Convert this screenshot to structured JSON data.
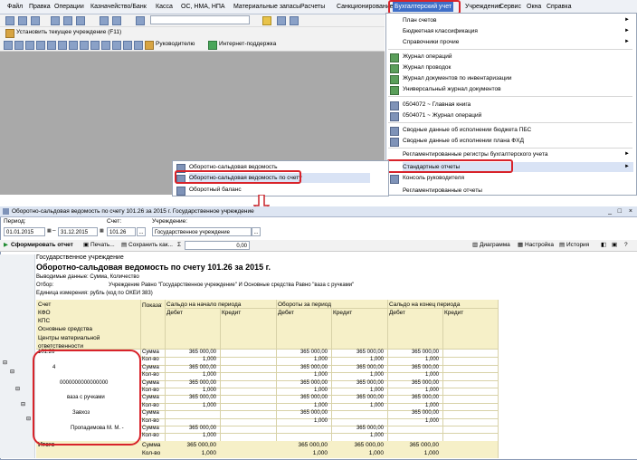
{
  "menu": [
    "Файл",
    "Правка",
    "Операции",
    "Казначейство/Банк",
    "Касса",
    "ОС, НМА, НПА",
    "Материальные запасы",
    "Расчеты",
    "Санкционирование",
    "Бухгалтерский учет",
    "Учреждение",
    "Сервис",
    "Окна",
    "Справка"
  ],
  "toolbar2": {
    "set_institution": "Установить текущее учреждение (F11)"
  },
  "toolbar3": {
    "manager": "Руководителю",
    "internet_support": "Интернет-поддержка"
  },
  "dropdown": {
    "items": [
      {
        "label": "План счетов",
        "arrow": "►"
      },
      {
        "label": "Бюджетная классификация",
        "arrow": "►"
      },
      {
        "label": "Справочники прочие",
        "arrow": "►"
      },
      {
        "label": "Журнал операций",
        "arrow": ""
      },
      {
        "label": "Журнал проводок",
        "arrow": ""
      },
      {
        "label": "Журнал документов по инвентаризации",
        "arrow": ""
      },
      {
        "label": "Универсальный журнал документов",
        "arrow": ""
      },
      {
        "label": "0504072 ~ Главная книга",
        "arrow": ""
      },
      {
        "label": "0504071 ~ Журнал операций",
        "arrow": ""
      },
      {
        "label": "Сводные данные об исполнении бюджета ПБС",
        "arrow": ""
      },
      {
        "label": "Сводные данные об исполнении плана ФХД",
        "arrow": ""
      },
      {
        "label": "Регламентированные регистры бухгалтерского учета",
        "arrow": "►"
      },
      {
        "label": "Стандартные отчеты",
        "arrow": "►"
      },
      {
        "label": "Консоль руководителя",
        "arrow": ""
      },
      {
        "label": "Регламентированные отчеты",
        "arrow": ""
      }
    ]
  },
  "submenu": [
    "Оборотно-сальдовая ведомость",
    "Оборотно-сальдовая ведомость по счету",
    "Оборотный баланс"
  ],
  "window": {
    "title": "Оборотно-сальдовая ведомость по счету 101.26 за 2015 г. Государственное учреждение",
    "period_label": "Период:",
    "date_from": "01.01.2015",
    "date_to": "31.12.2015",
    "account_label": "Счет:",
    "account": "101.26",
    "institution_label": "Учреждение:",
    "institution": "Государственное учреждение"
  },
  "report_toolbar": {
    "generate": "Сформировать отчет",
    "print": "Печать...",
    "save_as": "Сохранить как...",
    "sum_value": "0,00",
    "diagram": "Диаграмма",
    "settings": "Настройка",
    "history": "История"
  },
  "report": {
    "org": "Государственное учреждение",
    "title": "Оборотно-сальдовая ведомость по счету 101.26 за 2015 г.",
    "output_data": "Выводимые данные:  Сумма, Количество",
    "filter_label": "Отбор:",
    "filter": "Учреждение Равно \"Государственное учреждение\" И Основные средства Равно \"ваза с ручками\"",
    "unit": "Единица измерения: рубль (код по ОКЕИ 383)",
    "header_left": [
      "Счет",
      "КФО",
      "КПС",
      "Основные средства",
      "Центры материальной ответственности"
    ],
    "col_show": "Показатели",
    "col_open": "Сальдо на начало периода",
    "col_turn": "Обороты за период",
    "col_close": "Сальдо на конец периода",
    "debit": "Дебет",
    "credit": "Кредит",
    "rows": [
      {
        "label": "101.26",
        "ind": "Сумма",
        "v1": "365 000,00",
        "v2": "",
        "v3": "365 000,00",
        "v4": "365 000,00",
        "v5": "365 000,00"
      },
      {
        "label": "",
        "ind": "Кол-во",
        "v1": "1,000",
        "v2": "",
        "v3": "1,000",
        "v4": "1,000",
        "v5": "1,000"
      },
      {
        "label": "4",
        "ind": "Сумма",
        "v1": "365 000,00",
        "v2": "",
        "v3": "365 000,00",
        "v4": "365 000,00",
        "v5": "365 000,00"
      },
      {
        "label": "",
        "ind": "Кол-во",
        "v1": "1,000",
        "v2": "",
        "v3": "1,000",
        "v4": "1,000",
        "v5": "1,000"
      },
      {
        "label": "0000000000000000",
        "ind": "Сумма",
        "v1": "365 000,00",
        "v2": "",
        "v3": "365 000,00",
        "v4": "365 000,00",
        "v5": "365 000,00"
      },
      {
        "label": "",
        "ind": "Кол-во",
        "v1": "1,000",
        "v2": "",
        "v3": "1,000",
        "v4": "1,000",
        "v5": "1,000"
      },
      {
        "label": "ваза с ручками",
        "ind": "Сумма",
        "v1": "365 000,00",
        "v2": "",
        "v3": "365 000,00",
        "v4": "365 000,00",
        "v5": "365 000,00"
      },
      {
        "label": "",
        "ind": "Кол-во",
        "v1": "1,000",
        "v2": "",
        "v3": "1,000",
        "v4": "1,000",
        "v5": "1,000"
      },
      {
        "label": "Завхоз",
        "ind": "Сумма",
        "v1": "",
        "v2": "",
        "v3": "365 000,00",
        "v4": "",
        "v5": "365 000,00"
      },
      {
        "label": "",
        "ind": "Кол-во",
        "v1": "",
        "v2": "",
        "v3": "1,000",
        "v4": "",
        "v5": "1,000"
      },
      {
        "label": "Пропадимова М. М. -",
        "ind": "Сумма",
        "v1": "365 000,00",
        "v2": "",
        "v3": "",
        "v4": "365 000,00",
        "v5": ""
      },
      {
        "label": "",
        "ind": "Кол-во",
        "v1": "1,000",
        "v2": "",
        "v3": "",
        "v4": "1,000",
        "v5": ""
      }
    ],
    "total_label": "Итого",
    "total_rows": [
      {
        "ind": "Сумма",
        "v1": "365 000,00",
        "v2": "",
        "v3": "365 000,00",
        "v4": "365 000,00",
        "v5": "365 000,00"
      },
      {
        "ind": "Кол-во",
        "v1": "1,000",
        "v2": "",
        "v3": "1,000",
        "v4": "1,000",
        "v5": "1,000"
      }
    ]
  }
}
